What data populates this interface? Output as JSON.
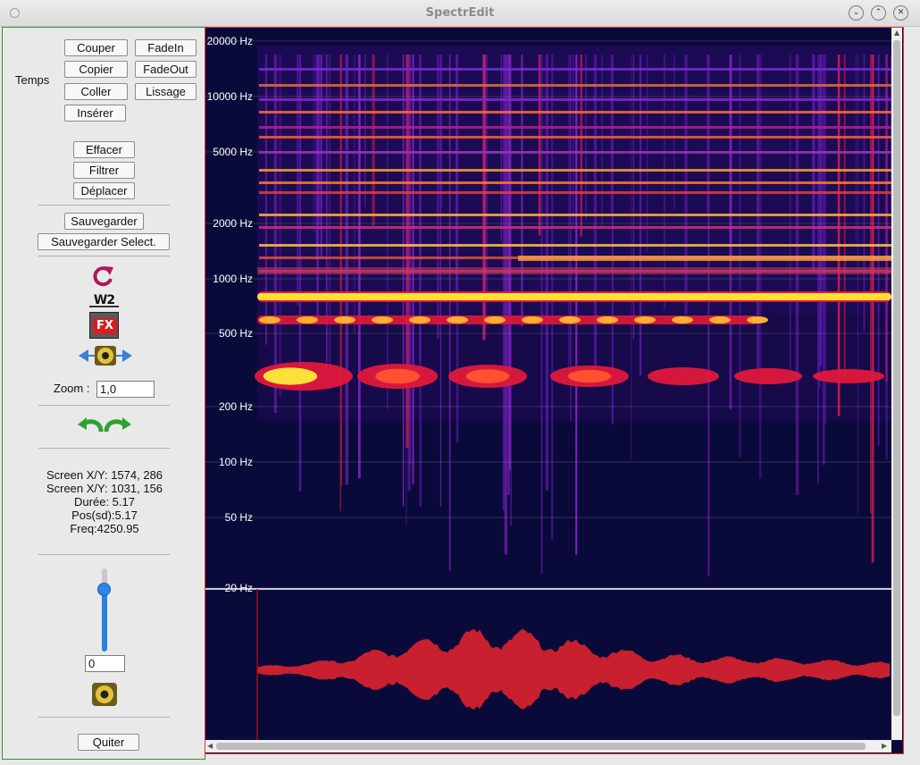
{
  "window": {
    "title": "SpectrEdit"
  },
  "edit": {
    "group_label": "Temps",
    "cut": "Couper",
    "copy": "Copier",
    "paste": "Coller",
    "insert": "Insérer",
    "fadein": "FadeIn",
    "fadeout": "FadeOut",
    "smooth": "Lissage"
  },
  "tools": {
    "erase": "Effacer",
    "filter": "Filtrer",
    "move": "Déplacer",
    "save": "Sauvegarder",
    "save_selection": "Sauvegarder Select."
  },
  "icons": {
    "refresh": "refresh-icon",
    "w2": "W2",
    "fx": "FX",
    "play_range": "speaker-range-icon",
    "undo_redo": "undo-redo-icon",
    "speaker": "speaker-icon"
  },
  "zoom": {
    "label": "Zoom :",
    "value": "1,0"
  },
  "info": {
    "screen1": "Screen X/Y: 1574, 286",
    "screen2": "Screen X/Y: 1031, 156",
    "duration": "Durée: 5.17",
    "position": "Pos(sd):5.17",
    "frequency": "Freq:4250.95"
  },
  "volume": {
    "slider_level": 0.75,
    "value": "0"
  },
  "quit": "Quiter",
  "spectrogram": {
    "freq_labels": [
      "20000 Hz",
      "10000 Hz",
      "5000 Hz",
      "2000 Hz",
      "1000 Hz",
      "500 Hz",
      "200 Hz",
      "100 Hz",
      "50 Hz",
      "20 Hz"
    ],
    "colors": {
      "background": "#0a0a3a",
      "low": "#5a1aa8",
      "mid": "#e0183c",
      "high": "#ffe03a",
      "waveform": "#c8202e",
      "cursor": "#9c1010"
    }
  }
}
